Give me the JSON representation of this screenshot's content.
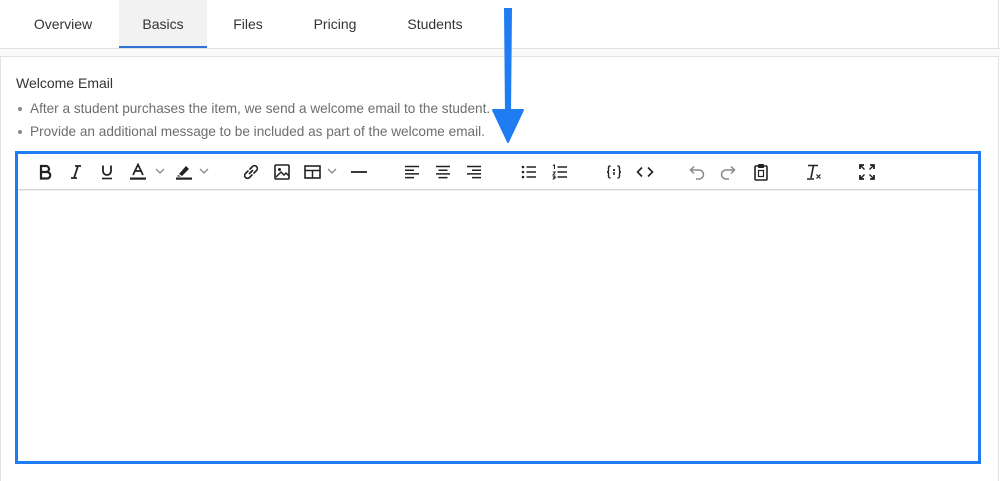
{
  "tabs": [
    {
      "label": "Overview",
      "active": false
    },
    {
      "label": "Basics",
      "active": true
    },
    {
      "label": "Files",
      "active": false
    },
    {
      "label": "Pricing",
      "active": false
    },
    {
      "label": "Students",
      "active": false
    }
  ],
  "welcome_email": {
    "title": "Welcome Email",
    "bullets": [
      "After a student purchases the item, we send a welcome email to the student.",
      "Provide an additional message to be included as part of the welcome email."
    ]
  },
  "toolbar_icons": [
    "bold-icon",
    "italic-icon",
    "underline-icon",
    "text-color-icon",
    "highlight-color-icon",
    "link-icon",
    "image-icon",
    "table-icon",
    "horizontal-line-icon",
    "align-left-icon",
    "align-center-icon",
    "align-right-icon",
    "bullet-list-icon",
    "numbered-list-icon",
    "variable-icon",
    "code-view-icon",
    "undo-icon",
    "redo-icon",
    "paste-icon",
    "clear-format-icon",
    "fullscreen-icon"
  ],
  "colors": {
    "accent": "#1f7cf2",
    "active_tab_underline": "#2f6fd6",
    "arrow": "#1f7cf2"
  },
  "editor": {
    "content": ""
  }
}
